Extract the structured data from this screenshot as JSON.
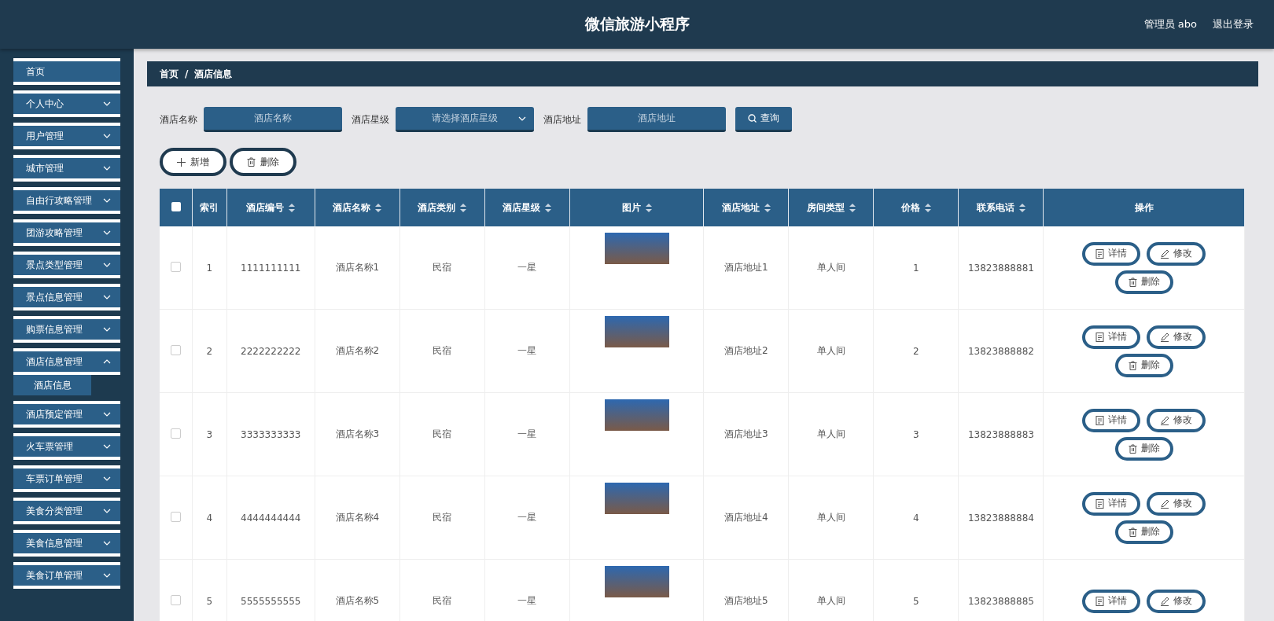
{
  "header": {
    "title": "微信旅游小程序",
    "user": "管理员 abo",
    "logout": "退出登录"
  },
  "sidebar": {
    "items": [
      {
        "label": "首页",
        "kind": "link"
      },
      {
        "label": "个人中心",
        "kind": "menu",
        "expanded": false
      },
      {
        "label": "用户管理",
        "kind": "menu",
        "expanded": false
      },
      {
        "label": "城市管理",
        "kind": "menu",
        "expanded": false
      },
      {
        "label": "自由行攻略管理",
        "kind": "menu",
        "expanded": false
      },
      {
        "label": "团游攻略管理",
        "kind": "menu",
        "expanded": false
      },
      {
        "label": "景点类型管理",
        "kind": "menu",
        "expanded": false
      },
      {
        "label": "景点信息管理",
        "kind": "menu",
        "expanded": false
      },
      {
        "label": "购票信息管理",
        "kind": "menu",
        "expanded": false
      },
      {
        "label": "酒店信息管理",
        "kind": "menu",
        "expanded": true,
        "children": [
          {
            "label": "酒店信息",
            "selected": true
          }
        ]
      },
      {
        "label": "酒店预定管理",
        "kind": "menu",
        "expanded": false
      },
      {
        "label": "火车票管理",
        "kind": "menu",
        "expanded": false
      },
      {
        "label": "车票订单管理",
        "kind": "menu",
        "expanded": false
      },
      {
        "label": "美食分类管理",
        "kind": "menu",
        "expanded": false
      },
      {
        "label": "美食信息管理",
        "kind": "menu",
        "expanded": false
      },
      {
        "label": "美食订单管理",
        "kind": "menu",
        "expanded": false
      }
    ]
  },
  "breadcrumb": [
    "首页",
    "/",
    "酒店信息"
  ],
  "search": {
    "fields": [
      {
        "label": "酒店名称",
        "kind": "input",
        "placeholder": "酒店名称"
      },
      {
        "label": "酒店星级",
        "kind": "select",
        "placeholder": "请选择酒店星级"
      },
      {
        "label": "酒店地址",
        "kind": "input",
        "placeholder": "酒店地址"
      }
    ],
    "button": "查询"
  },
  "toolbar": [
    {
      "label": "新增",
      "kind": "add"
    },
    {
      "label": "删除",
      "kind": "delete"
    }
  ],
  "table": {
    "select_all_checked": false,
    "columns": [
      {
        "label": "索引",
        "kind": "text",
        "sortable": false
      },
      {
        "label": "酒店编号",
        "kind": "text",
        "sortable": true
      },
      {
        "label": "酒店名称",
        "kind": "text",
        "sortable": true
      },
      {
        "label": "酒店类别",
        "kind": "text",
        "sortable": true
      },
      {
        "label": "酒店星级",
        "kind": "text",
        "sortable": true
      },
      {
        "label": "图片",
        "kind": "image",
        "sortable": true
      },
      {
        "label": "酒店地址",
        "kind": "text",
        "sortable": true
      },
      {
        "label": "房间类型",
        "kind": "text",
        "sortable": true
      },
      {
        "label": "价格",
        "kind": "text",
        "sortable": true
      },
      {
        "label": "联系电话",
        "kind": "text",
        "sortable": true
      },
      {
        "label": "操作",
        "kind": "actions",
        "sortable": false
      }
    ],
    "rows": [
      {
        "checked": false,
        "cells": [
          "1",
          "1111111111",
          "酒店名称1",
          "民宿",
          "一星",
          "",
          "酒店地址1",
          "单人间",
          "1",
          "13823888881"
        ],
        "actions": [
          {
            "label": "详情",
            "kind": "detail"
          },
          {
            "label": "修改",
            "kind": "edit"
          },
          {
            "label": "删除",
            "kind": "delete"
          }
        ]
      },
      {
        "checked": false,
        "cells": [
          "2",
          "2222222222",
          "酒店名称2",
          "民宿",
          "一星",
          "",
          "酒店地址2",
          "单人间",
          "2",
          "13823888882"
        ],
        "actions": [
          {
            "label": "详情",
            "kind": "detail"
          },
          {
            "label": "修改",
            "kind": "edit"
          },
          {
            "label": "删除",
            "kind": "delete"
          }
        ]
      },
      {
        "checked": false,
        "cells": [
          "3",
          "3333333333",
          "酒店名称3",
          "民宿",
          "一星",
          "",
          "酒店地址3",
          "单人间",
          "3",
          "13823888883"
        ],
        "actions": [
          {
            "label": "详情",
            "kind": "detail"
          },
          {
            "label": "修改",
            "kind": "edit"
          },
          {
            "label": "删除",
            "kind": "delete"
          }
        ]
      },
      {
        "checked": false,
        "cells": [
          "4",
          "4444444444",
          "酒店名称4",
          "民宿",
          "一星",
          "",
          "酒店地址4",
          "单人间",
          "4",
          "13823888884"
        ],
        "actions": [
          {
            "label": "详情",
            "kind": "detail"
          },
          {
            "label": "修改",
            "kind": "edit"
          },
          {
            "label": "删除",
            "kind": "delete"
          }
        ]
      },
      {
        "checked": false,
        "cells": [
          "5",
          "5555555555",
          "酒店名称5",
          "民宿",
          "一星",
          "",
          "酒店地址5",
          "单人间",
          "5",
          "13823888885"
        ],
        "actions": [
          {
            "label": "详情",
            "kind": "detail"
          },
          {
            "label": "修改",
            "kind": "edit"
          }
        ]
      }
    ]
  }
}
